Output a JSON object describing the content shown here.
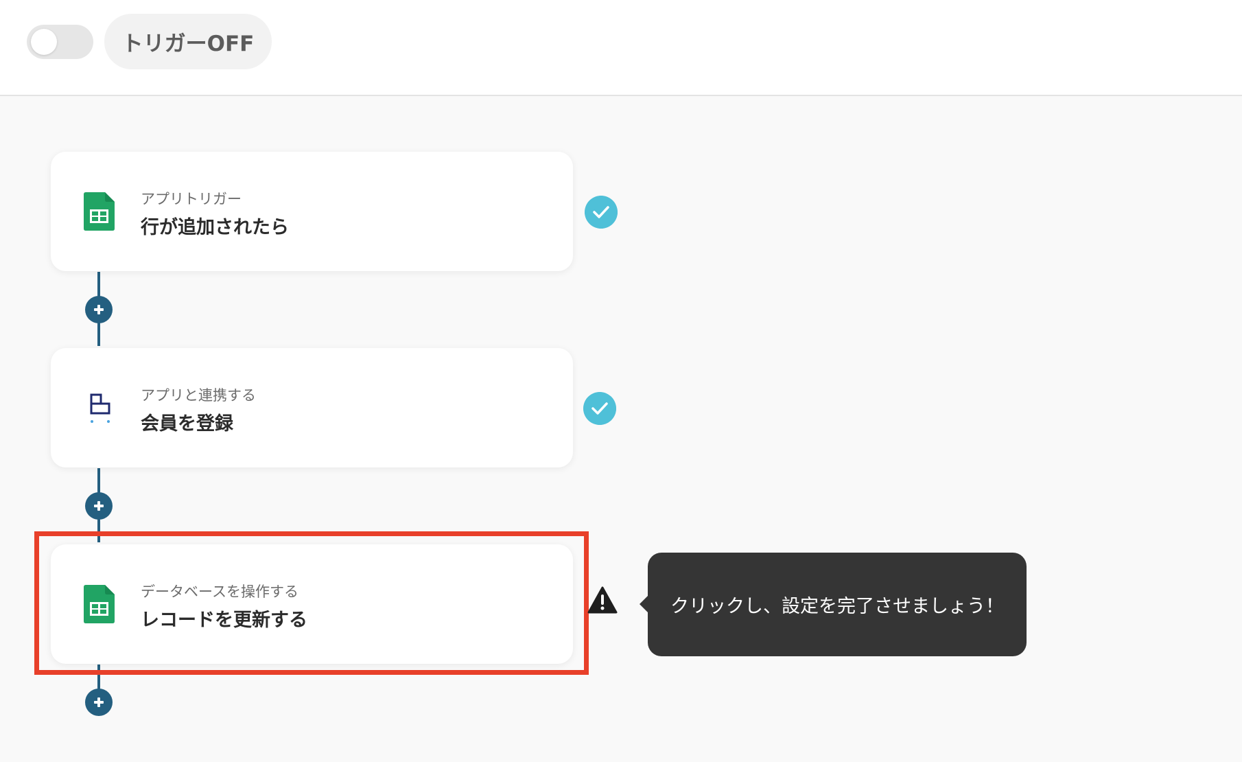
{
  "header": {
    "trigger_toggle_state": "off",
    "trigger_status_label": "トリガーOFF"
  },
  "flow": {
    "steps": [
      {
        "app_icon": "google-sheets-icon",
        "label": "アプリトリガー",
        "title": "行が追加されたら",
        "status": "complete"
      },
      {
        "app_icon": "member-app-icon",
        "label": "アプリと連携する",
        "title": "会員を登録",
        "status": "complete"
      },
      {
        "app_icon": "google-sheets-icon",
        "label": "データベースを操作する",
        "title": "レコードを更新する",
        "status": "incomplete"
      }
    ]
  },
  "tooltip": {
    "text": "クリックし、設定を完了させましょう！"
  },
  "colors": {
    "connector": "#245f80",
    "highlight": "#e8402a",
    "check": "#3bb0d1",
    "sheets_green": "#21a464",
    "tooltip_bg": "#353535"
  }
}
